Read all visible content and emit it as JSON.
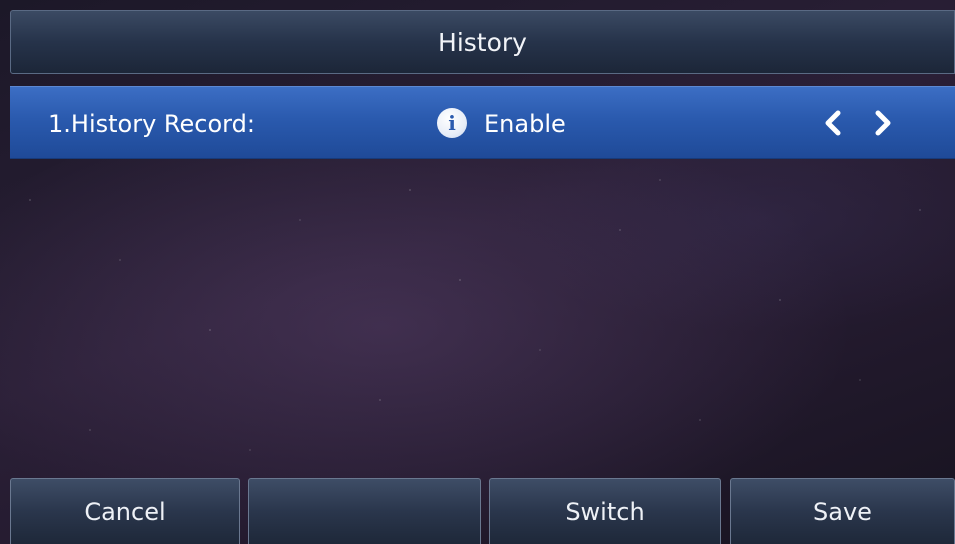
{
  "header": {
    "title": "History"
  },
  "setting_row": {
    "label": "1.History Record:",
    "value": "Enable",
    "info_icon": "info-icon",
    "left_arrow_icon": "chevron-left-icon",
    "right_arrow_icon": "chevron-right-icon"
  },
  "softkeys": [
    {
      "label": "Cancel"
    },
    {
      "label": ""
    },
    {
      "label": "Switch"
    },
    {
      "label": "Save"
    }
  ],
  "colors": {
    "selected_row": "#2a5aae",
    "title_bar": "#26334a",
    "softkey": "#2a364c",
    "text": "#ffffff"
  }
}
